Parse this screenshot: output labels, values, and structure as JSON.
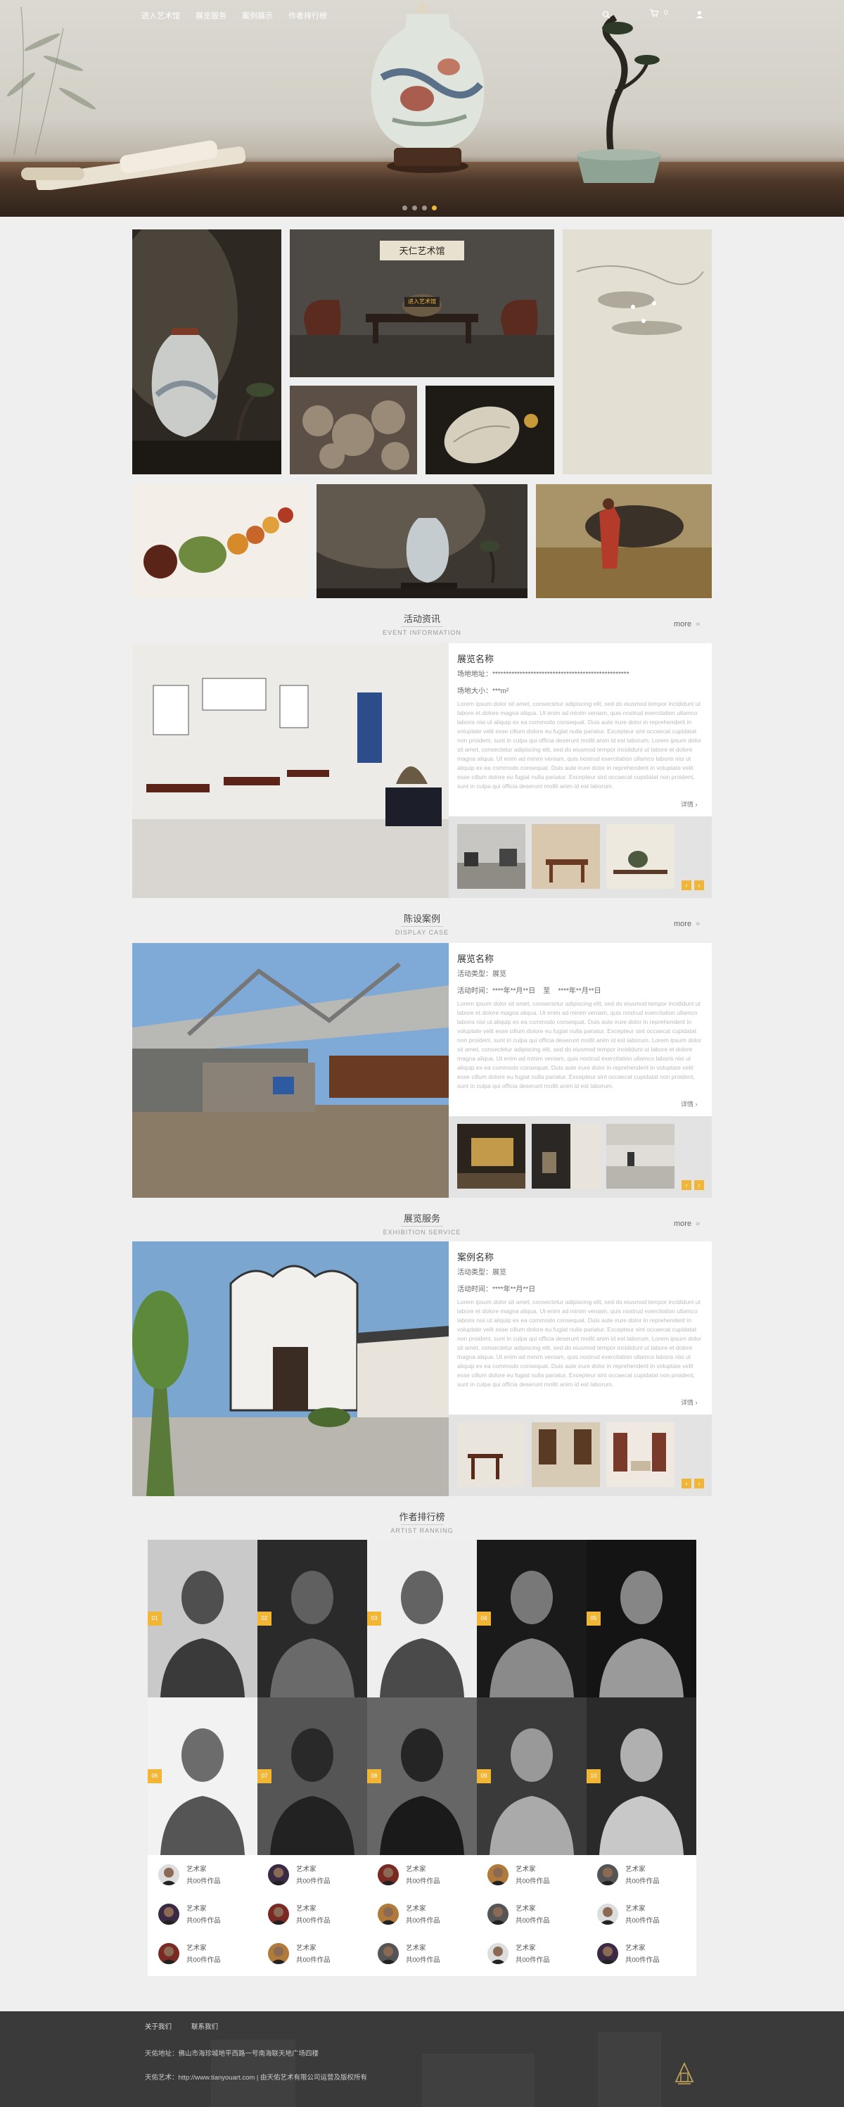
{
  "nav": {
    "items": [
      "进入艺术馆",
      "展览服务",
      "案例展示",
      "作者排行榜"
    ],
    "cart_count": "0"
  },
  "hero": {
    "slides": 4,
    "active_slide": 4,
    "center_button": "进入艺术馆"
  },
  "gallery": {
    "plaque_text": "天仁艺术馆",
    "enter_button": "进入艺术馆"
  },
  "events": {
    "title_cn": "活动资讯",
    "title_en": "EVENT INFORMATION",
    "more": "more",
    "name": "展览名称",
    "line1": "场地地址：**************************************************",
    "line2": "场地大小：***m²",
    "detail": "详情"
  },
  "cases": {
    "title_cn": "陈设案例",
    "title_en": "DISPLAY CASE",
    "more": "more",
    "name": "展览名称",
    "line1": "活动类型：展览",
    "line2": "活动时间：****年**月**日    至    ****年**月**日",
    "detail": "详情"
  },
  "services": {
    "title_cn": "展览服务",
    "title_en": "EXHIBITION SERVICE",
    "more": "more",
    "name": "案例名称",
    "line1": "活动类型：展览",
    "line2": "活动时间：****年**月**日",
    "detail": "详情"
  },
  "lorem": "Lorem ipsum dolor sit amet, consectetur adipiscing elit, sed do eiusmod tempor incididunt ut labore et dolore magna aliqua. Ut enim ad minim veniam, quis nostrud exercitation ullamco laboris nisi ut aliquip ex ea commodo consequat. Duis aute irure dolor in reprehenderit in voluptate velit esse cillum dolore eu fugiat nulla pariatur. Excepteur sint occaecat cupidatat non proident, sunt in culpa qui officia deserunt mollit anim id est laborum. Lorem ipsum dolor sit amet, consectetur adipiscing elit, sed do eiusmod tempor incididunt ut labore et dolore magna aliqua. Ut enim ad minim veniam, quis nostrud exercitation ullamco laboris nisi ut aliquip ex ea commodo consequat. Duis aute irure dolor in reprehenderit in voluptate velit esse cillum dolore eu fugiat nulla pariatur. Excepteur sint occaecat cupidatat non proident, sunt in culpa qui officia deserunt mollit anim id est laborum.",
  "ranking": {
    "title_cn": "作者排行榜",
    "title_en": "ARTIST RANKING",
    "badges": [
      "01",
      "02",
      "03",
      "04",
      "05",
      "06",
      "07",
      "08",
      "09",
      "10"
    ],
    "artist_label": "艺术家",
    "artist_count": "共00件作品"
  },
  "footer": {
    "links": [
      "关于我们",
      "联系我们"
    ],
    "address": "天佑地址：佛山市海珍城地平西路一号南海联天地广场四楼",
    "site": "天佑艺术：http://www.tianyouart.com | 由天佑艺术有限公司运营及版权所有"
  },
  "colors": {
    "accent": "#f2b636",
    "footer": "#3a3a3a"
  }
}
